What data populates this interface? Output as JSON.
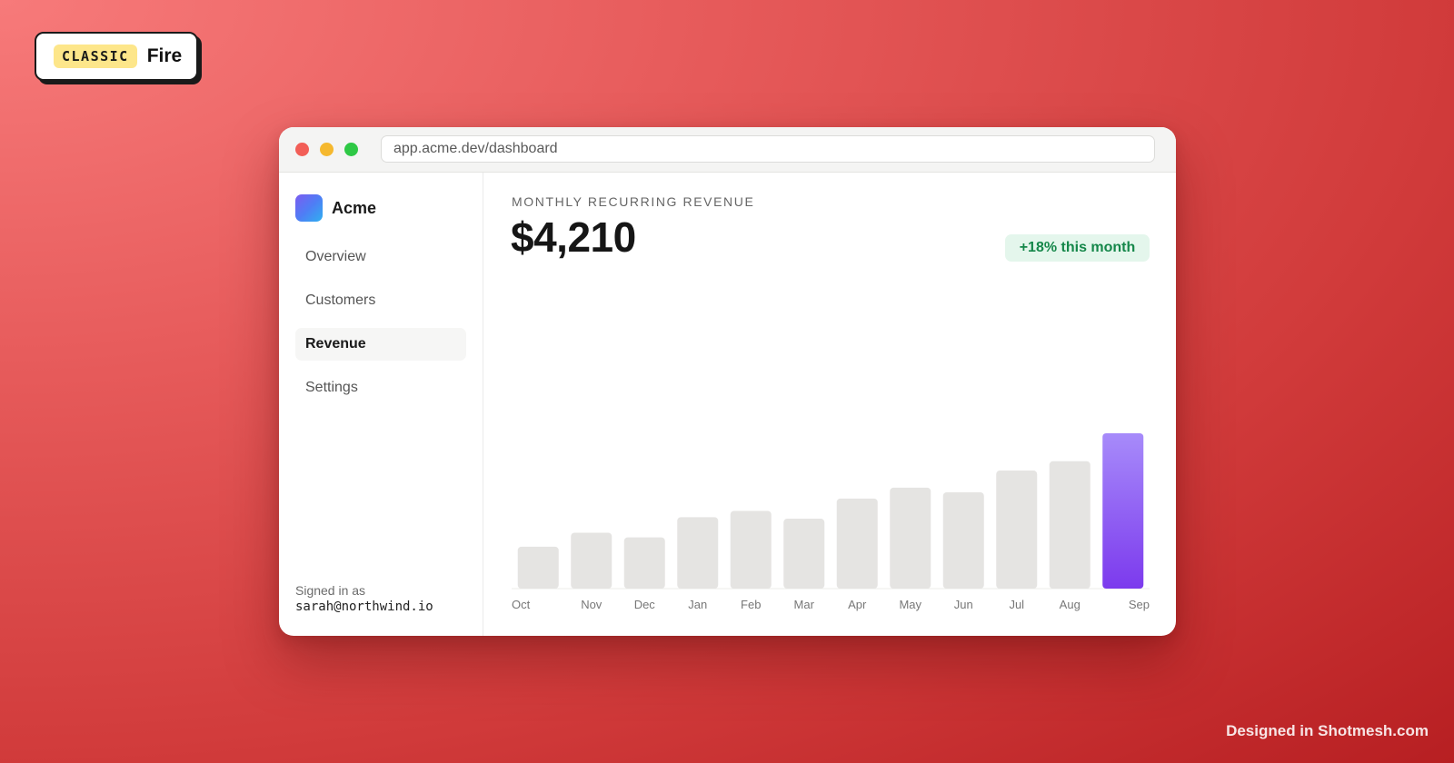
{
  "badge": {
    "tag": "CLASSIC",
    "name": "Fire"
  },
  "browser": {
    "url": "app.acme.dev/dashboard"
  },
  "sidebar": {
    "brand": "Acme",
    "items": [
      {
        "label": "Overview",
        "active": false
      },
      {
        "label": "Customers",
        "active": false
      },
      {
        "label": "Revenue",
        "active": true
      },
      {
        "label": "Settings",
        "active": false
      }
    ],
    "signed_in_label": "Signed in as",
    "signed_in_email": "sarah@northwind.io"
  },
  "main": {
    "kpi_label": "MONTHLY RECURRING REVENUE",
    "kpi_value": "$4,210",
    "delta": "+18% this month"
  },
  "chart_data": {
    "type": "bar",
    "categories": [
      "Oct",
      "Nov",
      "Dec",
      "Jan",
      "Feb",
      "Mar",
      "Apr",
      "May",
      "Jun",
      "Jul",
      "Aug",
      "Sep"
    ],
    "values": [
      27,
      36,
      33,
      46,
      50,
      45,
      58,
      65,
      62,
      76,
      82,
      100
    ],
    "highlight_index": 11,
    "bar_color": "#e5e4e2",
    "highlight_color_top": "#a78bfa",
    "highlight_color_bottom": "#7c3aed",
    "grid": false
  },
  "footer": {
    "credit": "Designed in Shotmesh.com"
  },
  "colors": {
    "accent": "#7c3aed",
    "positive": "#15874a"
  }
}
